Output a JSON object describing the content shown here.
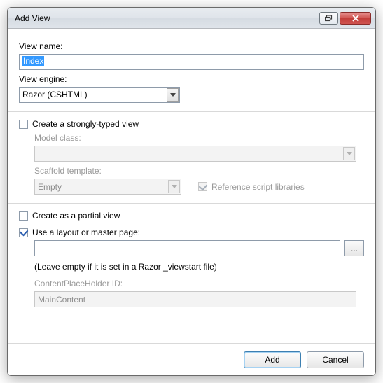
{
  "window": {
    "title": "Add View"
  },
  "labels": {
    "viewName": "View name:",
    "viewEngine": "View engine:",
    "createStrong": "Create a strongly-typed view",
    "modelClass": "Model class:",
    "scaffoldTemplate": "Scaffold template:",
    "refScript": "Reference script libraries",
    "partial": "Create as a partial view",
    "useLayout": "Use a layout or master page:",
    "layoutHint": "(Leave empty if it is set in a Razor _viewstart file)",
    "cphId": "ContentPlaceHolder ID:"
  },
  "values": {
    "viewName": "Index",
    "viewEngine": "Razor (CSHTML)",
    "modelClass": "",
    "scaffoldTemplate": "Empty",
    "layoutPath": "",
    "cphId": "MainContent",
    "browse": "..."
  },
  "buttons": {
    "add": "Add",
    "cancel": "Cancel"
  }
}
